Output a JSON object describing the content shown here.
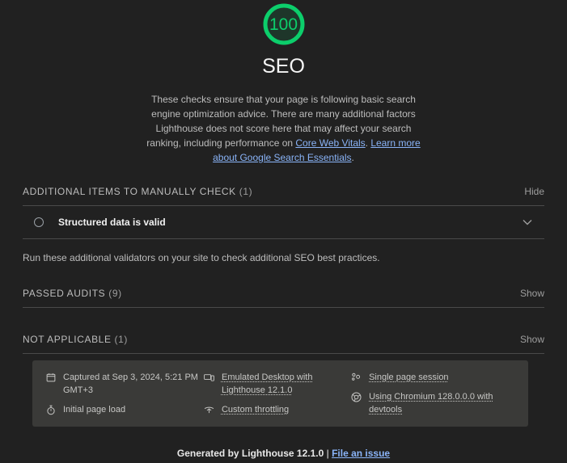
{
  "theme": {
    "background": "#212121",
    "score_green": "#0CCE6B",
    "link_blue": "#8AB4F8",
    "panel_bg": "#3a3a38"
  },
  "score": {
    "value": "100",
    "category_title": "SEO"
  },
  "description": {
    "part1": "These checks ensure that your page is following basic search engine optimization advice. There are many additional factors Lighthouse does not score here that may affect your search ranking, including performance on ",
    "link1": "Core Web Vitals",
    "part2": ". ",
    "link2": "Learn more about Google Search Essentials",
    "part3": "."
  },
  "manual_section": {
    "title": "ADDITIONAL ITEMS TO MANUALLY CHECK",
    "count": "(1)",
    "toggle": "Hide",
    "audits": [
      {
        "title": "Structured data is valid",
        "icon": "circle-icon",
        "chevron": "chevron-down-icon"
      }
    ],
    "note": "Run these additional validators on your site to check additional SEO best practices."
  },
  "passed_section": {
    "title": "PASSED AUDITS",
    "count": "(9)",
    "toggle": "Show"
  },
  "not_applicable_section": {
    "title": "NOT APPLICABLE",
    "count": "(1)",
    "toggle": "Show"
  },
  "metadata": {
    "column1": [
      {
        "icon": "calendar-icon",
        "text": "Captured at Sep 3, 2024, 5:21 PM GMT+3",
        "tooltip": false
      },
      {
        "icon": "stopwatch-icon",
        "text": "Initial page load",
        "tooltip": false
      }
    ],
    "column2": [
      {
        "icon": "devices-icon",
        "text": "Emulated Desktop with Lighthouse 12.1.0",
        "tooltip": true
      },
      {
        "icon": "network-icon",
        "text": "Custom throttling",
        "tooltip": true
      }
    ],
    "column3": [
      {
        "icon": "session-icon",
        "text": "Single page session",
        "tooltip": true
      },
      {
        "icon": "chromium-icon",
        "text": "Using Chromium 128.0.0.0 with devtools",
        "tooltip": true
      }
    ]
  },
  "footer": {
    "generated_prefix": "Generated by ",
    "brand": "Lighthouse",
    "version": " 12.1.0 ",
    "separator": "| ",
    "issue_link": "File an issue"
  }
}
